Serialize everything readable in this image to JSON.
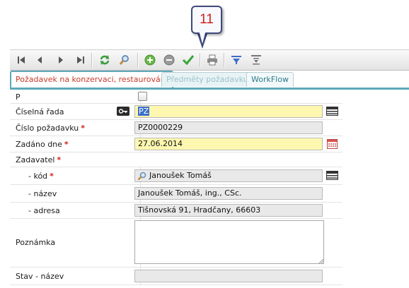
{
  "callout": {
    "number": "11"
  },
  "tabs": [
    {
      "label": "Požadavek na konzervaci, restaurování",
      "state": "active"
    },
    {
      "label": "Předměty požadavku",
      "state": "disabled"
    },
    {
      "label": "WorkFlow",
      "state": "normal"
    }
  ],
  "toolbar": {
    "icons": [
      "first-icon",
      "prev-icon",
      "next-icon",
      "last-icon",
      "refresh-icon",
      "search-icon",
      "add-icon",
      "remove-icon",
      "confirm-check-icon",
      "print-icon",
      "filter-icon",
      "filter-clear-icon"
    ]
  },
  "form": {
    "p": {
      "label": "P",
      "checked": false
    },
    "ciselna_rada": {
      "label": "Číselná řada",
      "value": "PZ"
    },
    "cislo": {
      "label": "Číslo požadavku",
      "required": "*",
      "value": "PZ0000229"
    },
    "zadano": {
      "label": "Zadáno dne",
      "required": "*",
      "value": "27.06.2014"
    },
    "zadavatel": {
      "label": "Zadavatel",
      "required": "*"
    },
    "kod": {
      "label": "- kód",
      "required": "*",
      "value": "Janoušek Tomáš"
    },
    "nazev": {
      "label": "- název",
      "value": "Janoušek Tomáš, ing., CSc."
    },
    "adresa": {
      "label": "- adresa",
      "value": "Tišnovská 91, Hradčany, 66603"
    },
    "poznamka": {
      "label": "Poznámka",
      "value": ""
    },
    "stav": {
      "label": "Stav - název",
      "value": ""
    }
  },
  "colors": {
    "accent": "#5ea8b8",
    "required": "#d0201a",
    "highlight": "#fdf7b0",
    "readonly": "#e9e9e9"
  }
}
